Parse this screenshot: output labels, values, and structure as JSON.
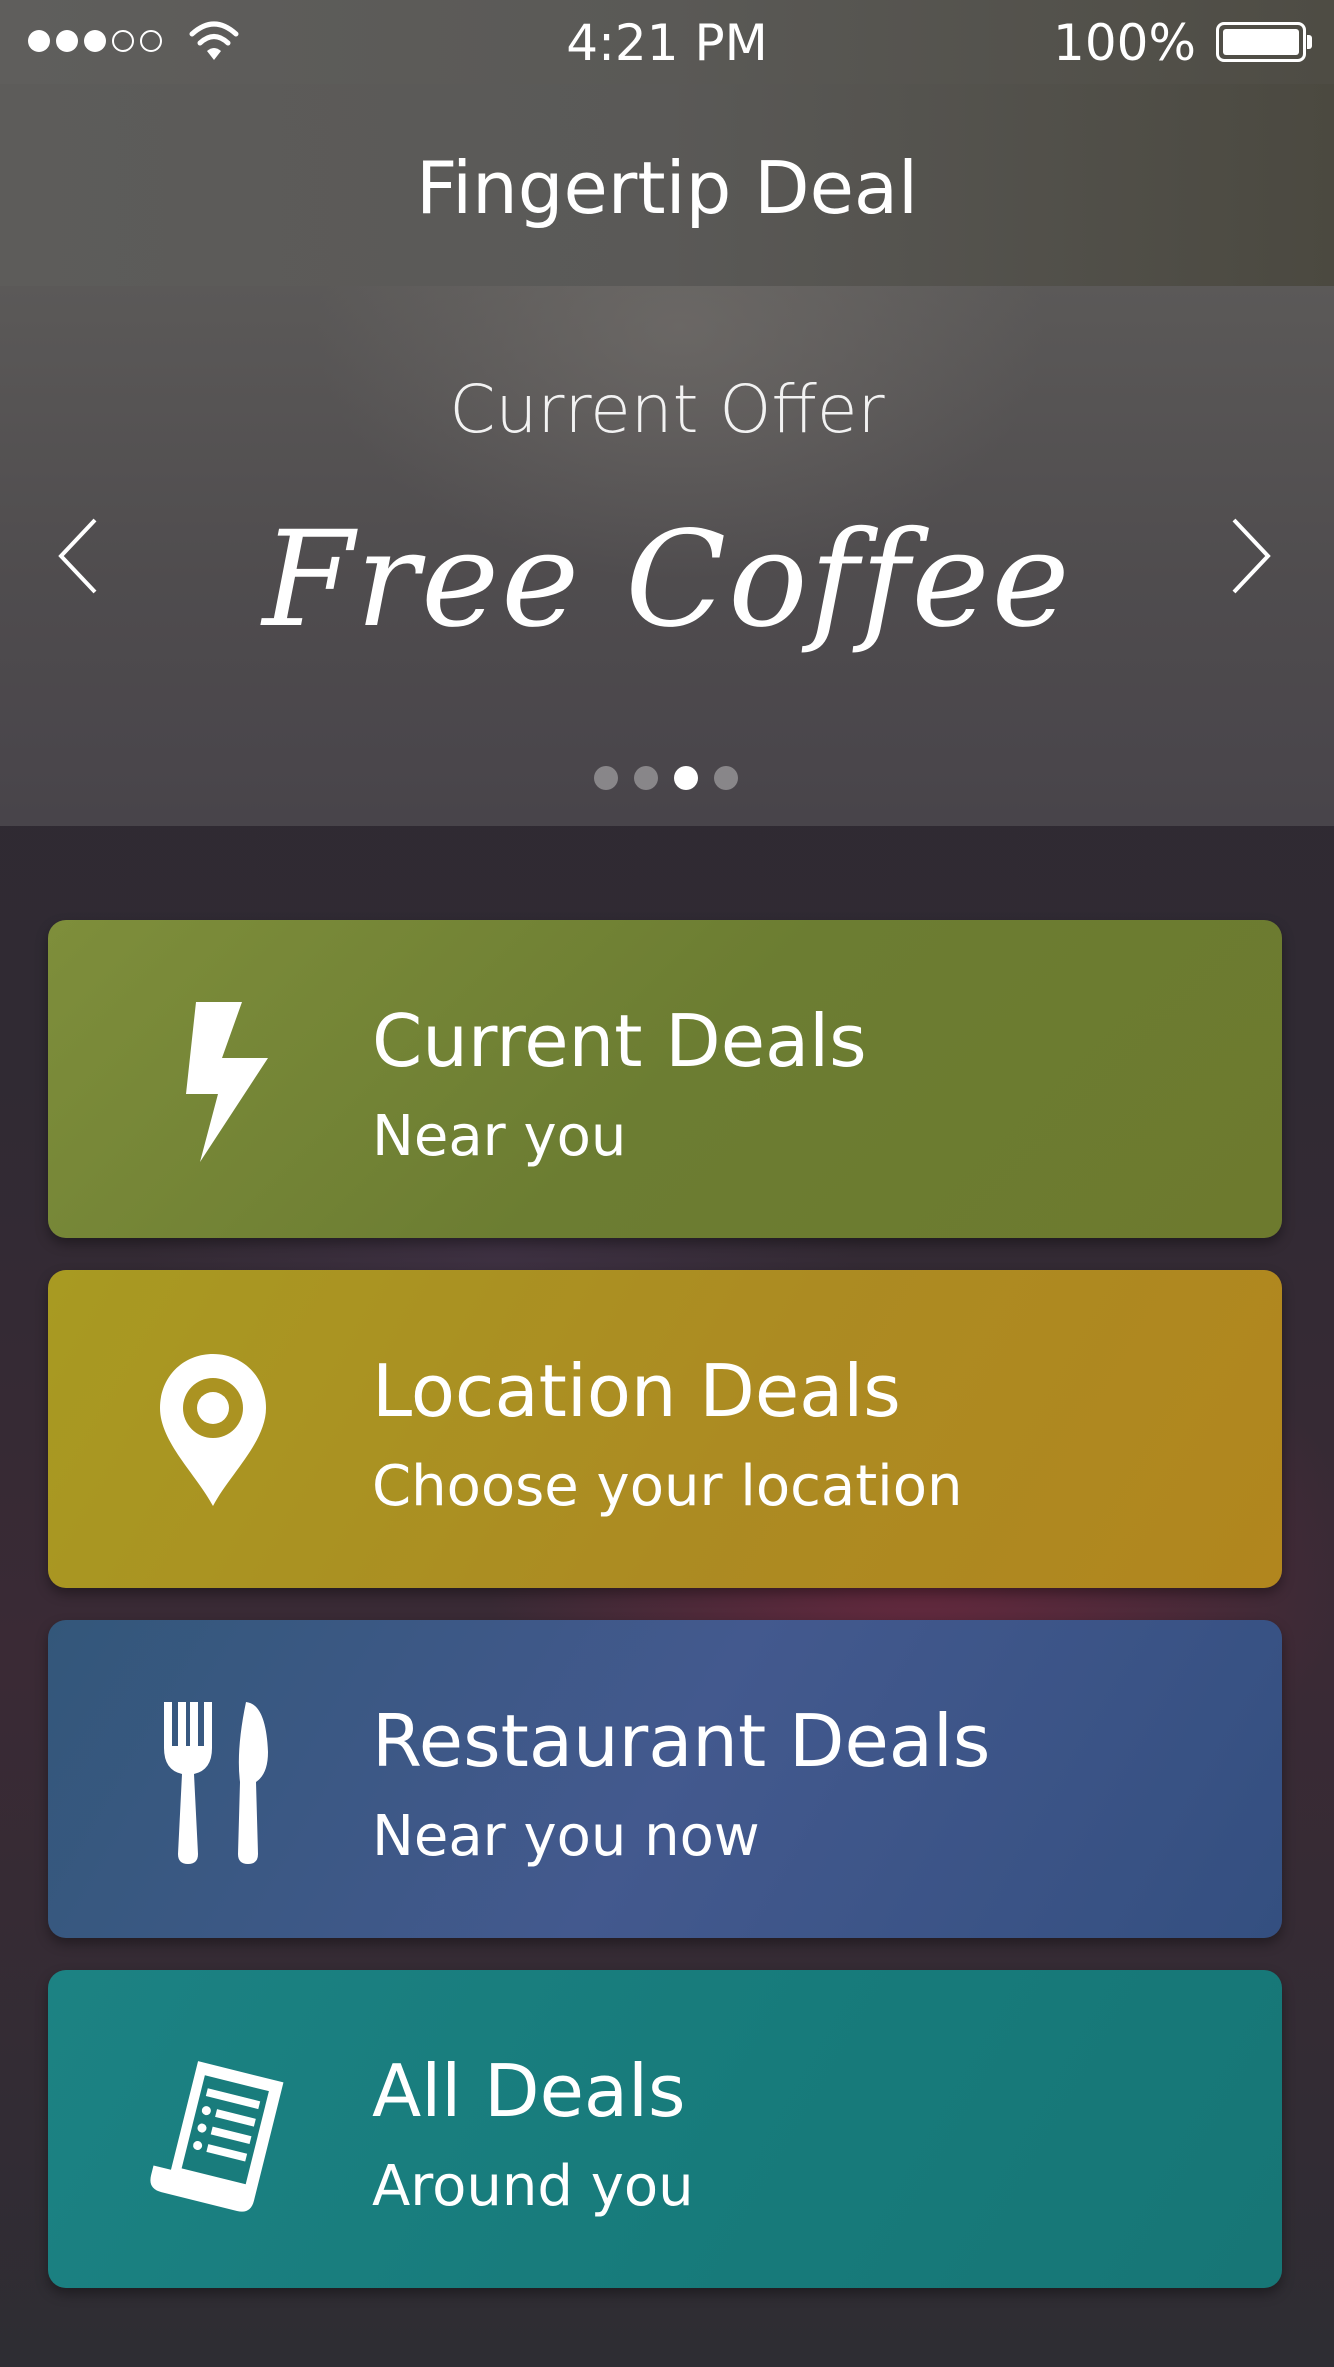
{
  "status_bar": {
    "signal_bars_filled": 3,
    "signal_bars_total": 5,
    "time": "4:21 PM",
    "battery": "100%"
  },
  "header": {
    "title": "Fingertip Deal"
  },
  "offer_carousel": {
    "label": "Current Offer",
    "title": "Free Coffee",
    "page_count": 4,
    "active_page": 3
  },
  "deal_categories": [
    {
      "title": "Current Deals",
      "subtitle": "Near you",
      "icon": "lightning-icon",
      "color": "#73843a"
    },
    {
      "title": "Location Deals",
      "subtitle": "Choose your location",
      "icon": "location-pin-icon",
      "color": "#ab8f22"
    },
    {
      "title": "Restaurant Deals",
      "subtitle": "Near you now",
      "icon": "fork-knife-icon",
      "color": "#3d5584"
    },
    {
      "title": "All Deals",
      "subtitle": "Around you",
      "icon": "receipt-list-icon",
      "color": "#197c7c"
    }
  ]
}
